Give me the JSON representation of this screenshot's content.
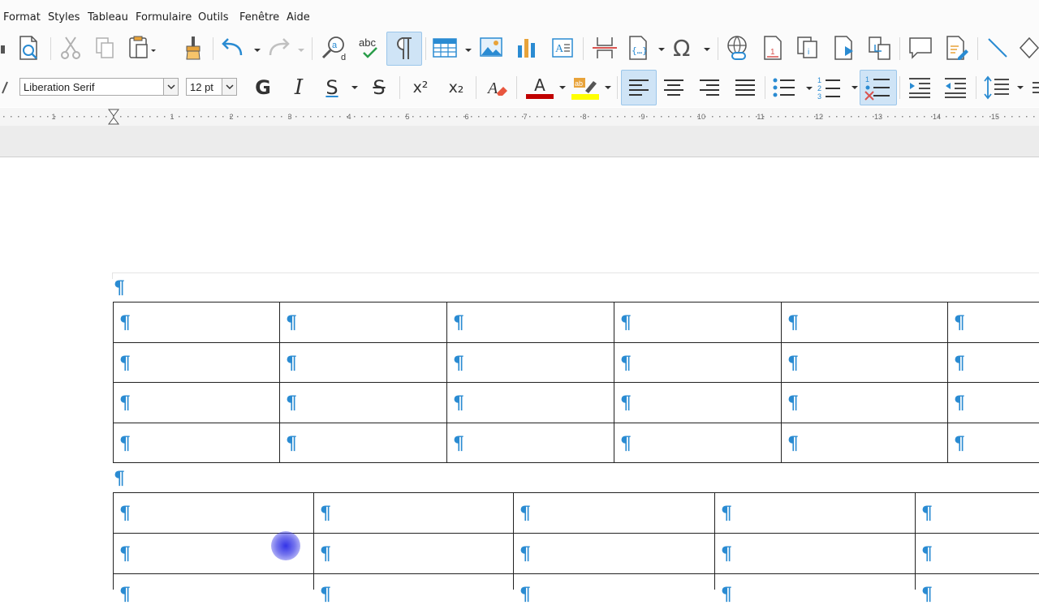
{
  "menu": {
    "items": [
      "Format",
      "Styles",
      "Tableau",
      "Formulaire",
      "Outils",
      "Fenêtre",
      "Aide"
    ]
  },
  "format_bar": {
    "font_name": "Liberation Serif",
    "font_size": "12 pt",
    "bold_label": "G",
    "italic_label": "I",
    "underline_label": "S",
    "strike_label": "S",
    "superscript_label": "x²",
    "subscript_label": "x₂",
    "font_color_label": "A",
    "font_color": "#c00000",
    "highlight_color": "#ffff00",
    "accent": "#2a8bd2"
  },
  "ruler": {
    "numbers": [
      "1",
      "1",
      "2",
      "3",
      "4",
      "5",
      "6",
      "7",
      "8",
      "9",
      "10",
      "11",
      "12",
      "13",
      "14",
      "15"
    ]
  },
  "document": {
    "pilcrow": "¶",
    "table1": {
      "rows": 4,
      "cols": 6
    },
    "table2": {
      "rows": 3,
      "cols": 5
    }
  }
}
